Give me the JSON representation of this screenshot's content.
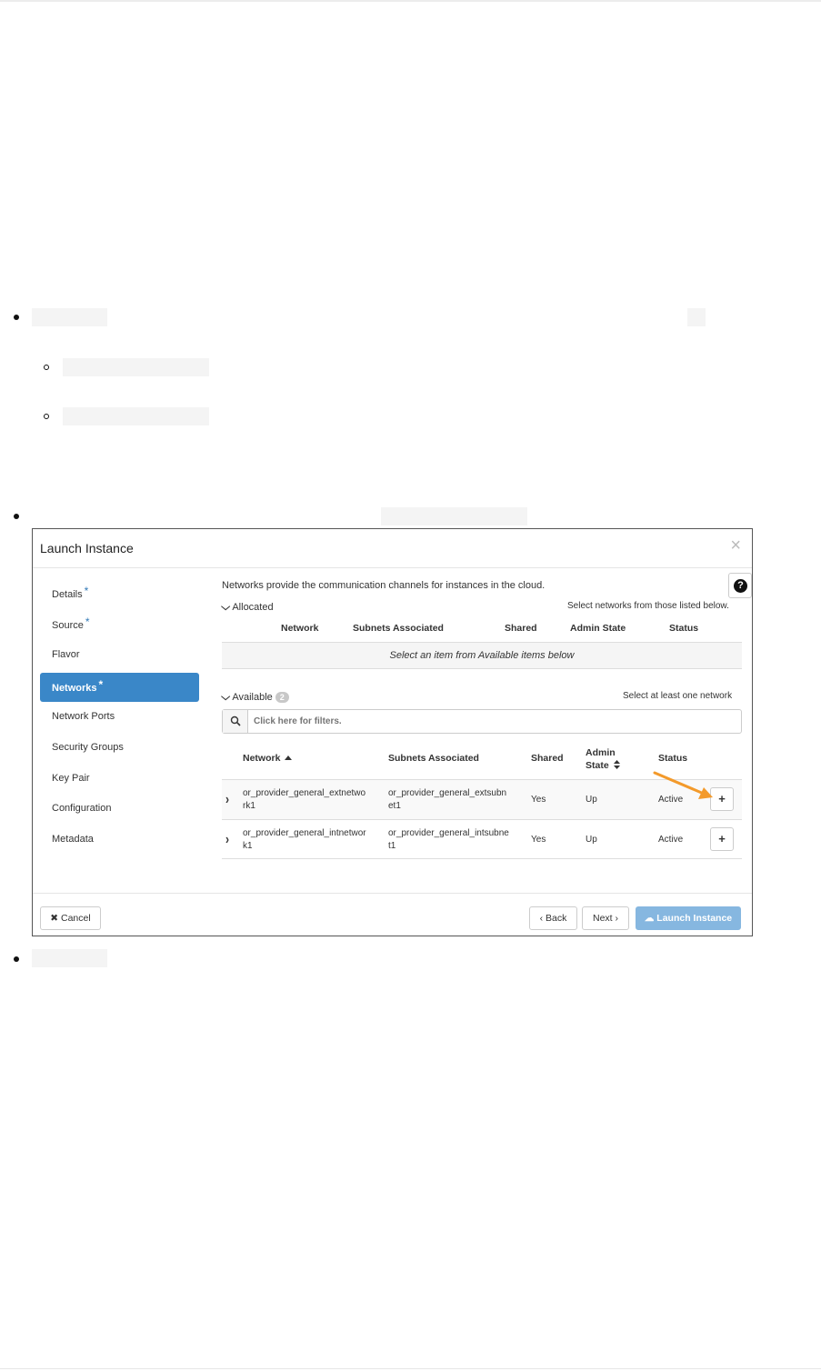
{
  "dialog": {
    "title": "Launch Instance",
    "close_glyph": "×",
    "nav": [
      {
        "label": "Details",
        "required": "*"
      },
      {
        "label": "Source",
        "required": "*"
      },
      {
        "label": "Flavor",
        "required": ""
      },
      {
        "label": "Networks",
        "required": "*"
      },
      {
        "label": "Network Ports",
        "required": ""
      },
      {
        "label": "Security Groups",
        "required": ""
      },
      {
        "label": "Key Pair",
        "required": ""
      },
      {
        "label": "Configuration",
        "required": ""
      },
      {
        "label": "Metadata",
        "required": ""
      }
    ],
    "active_nav": "Networks",
    "description": "Networks provide the communication channels for instances in the cloud.",
    "help_glyph": "?",
    "allocated": {
      "label": "Allocated",
      "hint": "Select networks from those listed below.",
      "headers": [
        "Network",
        "Subnets Associated",
        "Shared",
        "Admin State",
        "Status"
      ],
      "empty_text": "Select an item from Available items below"
    },
    "available": {
      "label": "Available",
      "count": "2",
      "hint": "Select at least one network",
      "filter_placeholder": "Click here for filters.",
      "headers": {
        "network": "Network",
        "subnets": "Subnets Associated",
        "shared": "Shared",
        "admin_state_1": "Admin",
        "admin_state_2": "State",
        "status": "Status"
      },
      "rows": [
        {
          "network_1": "or_provider_general_extnetwo",
          "network_2": "rk1",
          "subnet_1": "or_provider_general_extsubn",
          "subnet_2": "et1",
          "shared": "Yes",
          "admin_state": "Up",
          "status": "Active",
          "add": "+"
        },
        {
          "network_1": "or_provider_general_intnetwor",
          "network_2": "k1",
          "subnet_1": "or_provider_general_intsubne",
          "subnet_2": "t1",
          "shared": "Yes",
          "admin_state": "Up",
          "status": "Active",
          "add": "+"
        }
      ]
    },
    "footer": {
      "cancel": "✖ Cancel",
      "back": "‹ Back",
      "next": "Next ›",
      "launch": "☁ Launch Instance"
    }
  },
  "colors": {
    "active_nav": "#3a87c8",
    "launch_button": "#86b7e0",
    "annotation_arrow": "#f39a2b"
  },
  "icons": [
    "help-icon",
    "search-icon",
    "chevron-down-icon",
    "chevron-right-icon",
    "plus-icon",
    "cloud-upload-icon",
    "times-icon"
  ]
}
